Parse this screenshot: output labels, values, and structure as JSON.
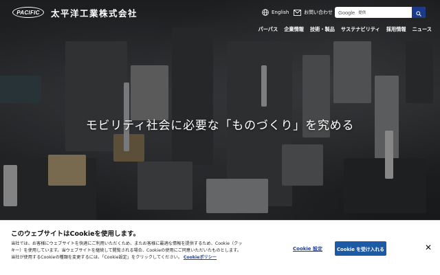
{
  "header": {
    "logo_text": "PACIFIC",
    "company_name": "太平洋工業株式会社",
    "language_label": "English",
    "contact_label": "お問い合わせ",
    "search": {
      "brand": "Google",
      "placeholder": "提供"
    }
  },
  "nav": {
    "items": [
      "パーパス",
      "企業情報",
      "技術・製品",
      "サステナビリティ",
      "採用情報",
      "ニュース"
    ]
  },
  "hero": {
    "headline": "モビリティ社会に必要な「ものづくり」を究める"
  },
  "cookie_banner": {
    "title": "このウェブサイトはCookieを使用します。",
    "description": "当社では、お客様にウェブサイトを快適にご利用いただくため、またお客様に最適な情報を提供するため、Cookie（クッキー）を使用しています。当ウェブサイトを継続して閲覧される場合、Cookieの使用にご同意いただいたものとします。当社が使用するCookieの種類を変更するには、「Cookie設定」をクリックしてください。",
    "policy_link": "Cookieポリシー",
    "settings_label": "Cookie 設定",
    "accept_label": "Cookie を受け入れる",
    "close_symbol": "✕"
  },
  "colors": {
    "accent_blue": "#1d5aa6",
    "link_blue": "#1d3f9a",
    "search_button": "#1b3a8c"
  }
}
